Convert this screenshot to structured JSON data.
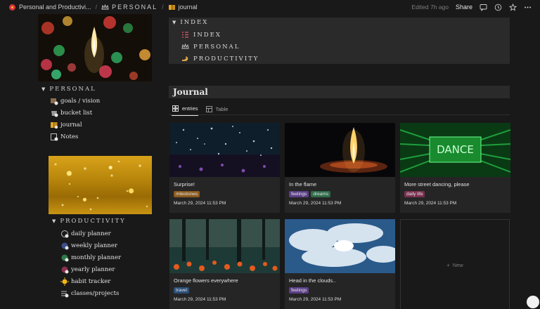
{
  "topbar": {
    "breadcrumbs": [
      {
        "icon": "hibiscus-icon",
        "label": "Personal and Productivi..."
      },
      {
        "icon": "crown-icon",
        "label": "PERSONAL"
      },
      {
        "icon": "book-icon",
        "label": "journal"
      }
    ],
    "edited": "Edited 7h ago",
    "share": "Share",
    "icons": [
      "comment-icon",
      "clock-icon",
      "star-icon",
      "more-icon"
    ]
  },
  "personal": {
    "heading": "PERSONAL",
    "items": [
      {
        "icon": "goals-icon",
        "label": "goals / vision"
      },
      {
        "icon": "bucket-icon",
        "label": "bucket list"
      },
      {
        "icon": "book-icon",
        "label": "journal"
      },
      {
        "icon": "notes-icon",
        "label": "Notes"
      }
    ]
  },
  "productivity": {
    "heading": "PRODUCTIVITY",
    "items": [
      {
        "icon": "daily-planner-icon",
        "label": "daily planner"
      },
      {
        "icon": "weekly-planner-icon",
        "label": "weekly planner"
      },
      {
        "icon": "monthly-planner-icon",
        "label": "monthly planner"
      },
      {
        "icon": "yearly-planner-icon",
        "label": "yearly planner"
      },
      {
        "icon": "habit-tracker-icon",
        "label": "habit tracker"
      },
      {
        "icon": "classes-icon",
        "label": "classes/projects"
      }
    ]
  },
  "index": {
    "heading": "INDEX",
    "items": [
      {
        "icon": "list-icon",
        "label": "INDEX"
      },
      {
        "icon": "crown-icon",
        "label": "PERSONAL"
      },
      {
        "icon": "flex-arm-icon",
        "label": "PRODUCTIVITY"
      }
    ]
  },
  "journal": {
    "title": "Journal",
    "tabs": [
      {
        "icon": "gallery-icon",
        "label": "entries"
      },
      {
        "icon": "table-icon",
        "label": "Table"
      }
    ],
    "cards": [
      {
        "title": "Surprise!",
        "tags": [
          {
            "label": "milestones",
            "color": "#8a5a1f"
          }
        ],
        "date": "March 29, 2024 11:53 PM"
      },
      {
        "title": "In the flame",
        "tags": [
          {
            "label": "feelings",
            "color": "#5b3f87"
          },
          {
            "label": "dreams",
            "color": "#2f6b4a"
          }
        ],
        "date": "March 29, 2024 11:53 PM"
      },
      {
        "title": "More street dancing, please",
        "tags": [
          {
            "label": "daily life",
            "color": "#7a2f4f"
          }
        ],
        "date": "March 29, 2024 11:53 PM"
      },
      {
        "title": "Orange flowers everywhere",
        "tags": [
          {
            "label": "travel",
            "color": "#2b4f78"
          }
        ],
        "date": "March 29, 2024 11:53 PM"
      },
      {
        "title": "Head in the clouds..",
        "tags": [
          {
            "label": "feelings",
            "color": "#5b3f87"
          }
        ],
        "date": "March 29, 2024 11:53 PM"
      }
    ],
    "new_label": "New"
  },
  "images": {
    "dance_sign": "DANCE"
  }
}
